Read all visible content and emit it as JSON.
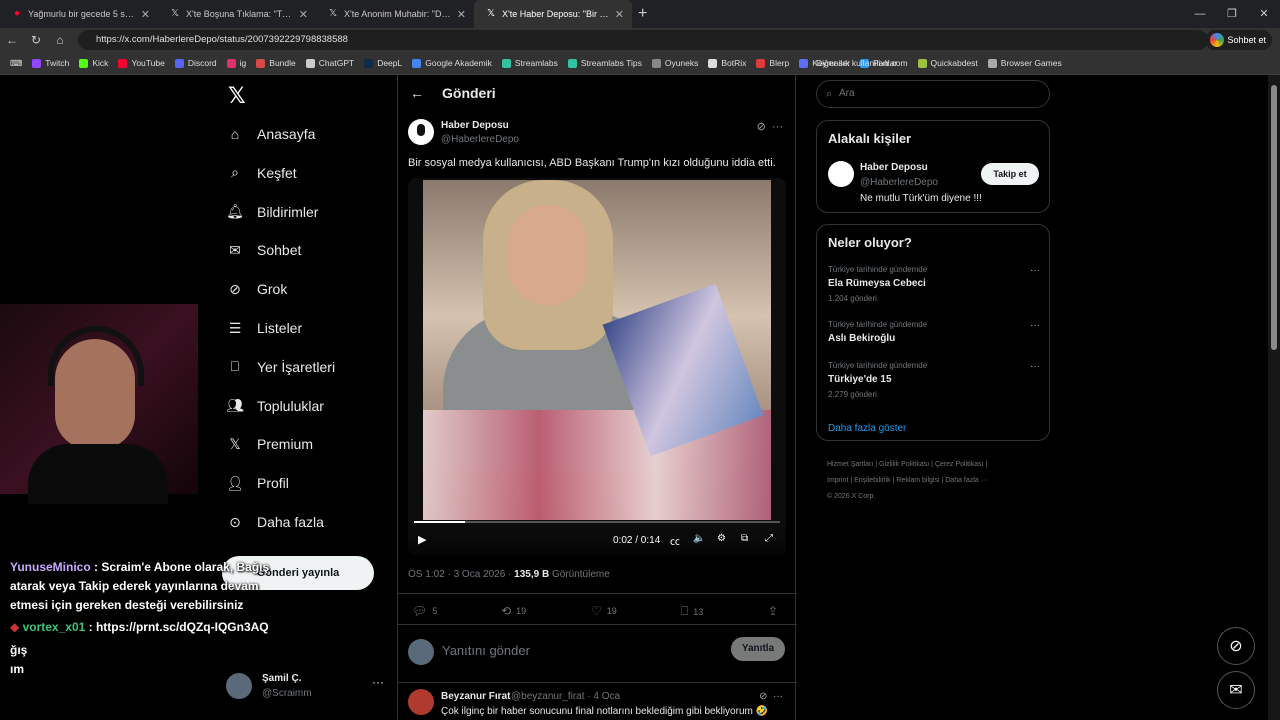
{
  "browser": {
    "tabs": [
      {
        "title": "Yağmurlu bir gecede 5 saat araç ku",
        "icon": "youtube-icon",
        "color": "#ff0033",
        "active": false
      },
      {
        "title": "X'te Boşuna Tıklama: \"Trump'ın kız",
        "icon": "x-icon",
        "color": "#ffffff",
        "active": false
      },
      {
        "title": "X'te Anonim Muhabir: \"Donald Tru",
        "icon": "x-icon",
        "color": "#ffffff",
        "active": false
      },
      {
        "title": "X'te Haber Deposu: \"Bir sosyal me",
        "icon": "x-icon",
        "color": "#ffffff",
        "active": true
      }
    ],
    "url": "https://x.com/HaberlereDepo/status/2007392229798838588",
    "chat_button": "Sohbet et",
    "bookmarks": [
      {
        "label": "Twitch",
        "color": "#9146ff"
      },
      {
        "label": "Kick",
        "color": "#53fc18"
      },
      {
        "label": "YouTube",
        "color": "#ff0033"
      },
      {
        "label": "Discord",
        "color": "#5865f2"
      },
      {
        "label": "ig",
        "color": "#e1306c"
      },
      {
        "label": "Bundle",
        "color": "#d84a4a"
      },
      {
        "label": "ChatGPT",
        "color": "#cccccc"
      },
      {
        "label": "DeepL",
        "color": "#0f2b46"
      },
      {
        "label": "Google Akademik",
        "color": "#4285f4"
      },
      {
        "label": "Streamlabs",
        "color": "#31c3a2"
      },
      {
        "label": "Streamlabs Tips",
        "color": "#31c3a2"
      },
      {
        "label": "Oyuneks",
        "color": "#888888"
      },
      {
        "label": "BotRix",
        "color": "#dddddd"
      },
      {
        "label": "Blerp",
        "color": "#e03a3a"
      },
      {
        "label": "Keymailer",
        "color": "#5c6ef5"
      },
      {
        "label": "Pixlr.com",
        "color": "#2b9af3"
      },
      {
        "label": "Quickabdest",
        "color": "#a0c040"
      },
      {
        "label": "Browser Games",
        "color": "#aaaaaa"
      }
    ],
    "other_bookmarks": "Diğer sık kullanılanlar"
  },
  "nav": {
    "items": [
      {
        "label": "Anasayfa",
        "icon": "home-icon"
      },
      {
        "label": "Keşfet",
        "icon": "search-icon"
      },
      {
        "label": "Bildirimler",
        "icon": "bell-icon"
      },
      {
        "label": "Sohbet",
        "icon": "mail-icon"
      },
      {
        "label": "Grok",
        "icon": "grok-icon"
      },
      {
        "label": "Listeler",
        "icon": "list-icon"
      },
      {
        "label": "Yer İşaretleri",
        "icon": "bookmark-icon"
      },
      {
        "label": "Topluluklar",
        "icon": "communities-icon"
      },
      {
        "label": "Premium",
        "icon": "x-logo-icon"
      },
      {
        "label": "Profil",
        "icon": "profile-icon"
      },
      {
        "label": "Daha fazla",
        "icon": "more-circle-icon"
      }
    ],
    "post_button": "Gönderi yayınla",
    "account": {
      "name": "Şamil Ç.",
      "handle": "@Scraimm"
    }
  },
  "stream_chat": {
    "msg1_user": "YunuseMinico",
    "msg1_text": ": Scraim'e Abone olarak, Bağış atarak veya Takip ederek yayınlarına devam etmesi için gereken desteği verebilirsiniz",
    "msg2_user": "vortex_x01",
    "msg2_text": ": https://prnt.sc/dQZq-IQGn3AQ",
    "line3": "ğış",
    "line4": "ım"
  },
  "post": {
    "header": "Gönderi",
    "author": "Haber Deposu",
    "handle": "@HaberlereDepo",
    "text": "Bir sosyal medya kullanıcısı, ABD Başkanı Trump'ın kızı olduğunu iddia etti.",
    "video": {
      "time": "0:02 / 0:14",
      "progress": 0.14
    },
    "timestamp": "ÖS 1:02 · 3 Oca 2026 · ",
    "views": "135,9 B",
    "views_label": " Görüntüleme",
    "stats": {
      "replies": "5",
      "reposts": "19",
      "likes": "19",
      "bookmarks": "13"
    },
    "reply_placeholder": "Yanıtını gönder",
    "reply_button": "Yanıtla"
  },
  "comment": {
    "name": "Beyzanur Fırat",
    "handle": "@beyzanur_firat · 4 Oca",
    "text": "Çok ilginç bir haber sonucunu final notlarını beklediğim gibi bekliyorum 🤣"
  },
  "sidebar": {
    "search_placeholder": "Ara",
    "related": {
      "title": "Alakalı kişiler",
      "name": "Haber Deposu",
      "handle": "@HaberlereDepo",
      "bio": "Ne mutlu Türk'üm diyene !!!",
      "follow": "Takip et"
    },
    "trends": {
      "title": "Neler oluyor?",
      "items": [
        {
          "context": "Türkiye tarihinde gündemde",
          "topic": "Ela Rümeysa Cebeci",
          "posts": "1.204 gönderi"
        },
        {
          "context": "Türkiye tarihinde gündemde",
          "topic": "Aslı Bekiroğlu",
          "posts": ""
        },
        {
          "context": "Türkiye tarihinde gündemde",
          "topic": "Türkiye'de 15",
          "posts": "2.279 gönderi"
        }
      ],
      "more": "Daha fazla göster"
    },
    "footer": {
      "line1": "Hizmet Şartları  |  Gizlilik Politikası  |  Çerez Politikası  |",
      "line2": "Imprint  |  Erişilebilirlik  |  Reklam bilgisi  |  Daha fazla ···",
      "line3": "© 2026 X Corp."
    }
  }
}
